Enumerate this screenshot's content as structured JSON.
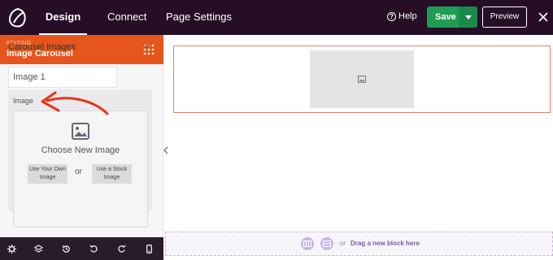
{
  "topbar": {
    "logo_icon": "leaf-logo-icon",
    "tabs": [
      {
        "label": "Design"
      },
      {
        "label": "Connect"
      },
      {
        "label": "Page Settings"
      }
    ],
    "help_label": "Help",
    "save_label": "Save",
    "preview_label": "Preview",
    "close_icon": "close-icon"
  },
  "sidebar": {
    "editing_label": "EDITING",
    "block_title": "Image Carousel",
    "section_title": "Carousel Images",
    "item_tab_label": "Image 1",
    "image_label": "Image",
    "choose_label": "Choose New Image",
    "own_image_label": "Use Your Own Image",
    "or_label": "or",
    "stock_image_label": "Use a Stock Image",
    "toolbar_icons": [
      "gear-icon",
      "layers-icon",
      "history-icon",
      "undo-icon",
      "redo-icon",
      "mobile-icon"
    ]
  },
  "canvas": {
    "dropzone_or": "or",
    "dropzone_label": "Drag a new block here"
  },
  "colors": {
    "topbar_bg": "#260f26",
    "accent_orange": "#e5551c",
    "save_green": "#1f9d55",
    "annotation_red": "#e8341c"
  }
}
